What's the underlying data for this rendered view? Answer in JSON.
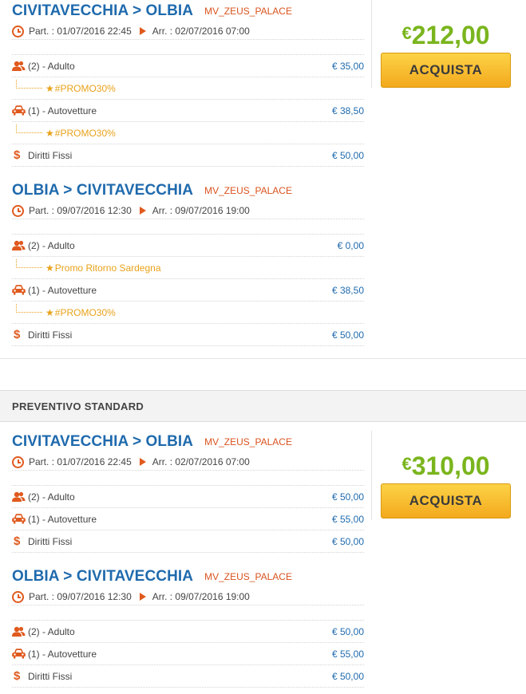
{
  "quote_promo": {
    "total_currency": "€",
    "total_amount": "212,00",
    "buy_label": "ACQUISTA",
    "legs": [
      {
        "route": "CIVITAVECCHIA > OLBIA",
        "ship": "MV_ZEUS_PALACE",
        "departure": "Part. : 01/07/2016 22:45",
        "arrival": "Arr. : 02/07/2016 07:00",
        "rows": [
          {
            "icon": "passengers-icon",
            "label": "(2) - Adulto",
            "price": "€ 35,00"
          },
          {
            "promo": "#PROMO30%"
          },
          {
            "icon": "car-icon",
            "label": "(1) - Autovetture",
            "price": "€ 38,50"
          },
          {
            "promo": "#PROMO30%"
          },
          {
            "icon": "dollar-icon",
            "label": "Diritti Fissi",
            "price": "€ 50,00"
          }
        ]
      },
      {
        "route": "OLBIA > CIVITAVECCHIA",
        "ship": "MV_ZEUS_PALACE",
        "departure": "Part. : 09/07/2016 12:30",
        "arrival": "Arr. : 09/07/2016 19:00",
        "rows": [
          {
            "icon": "passengers-icon",
            "label": "(2) - Adulto",
            "price": "€ 0,00"
          },
          {
            "promo": "Promo Ritorno Sardegna"
          },
          {
            "icon": "car-icon",
            "label": "(1) - Autovetture",
            "price": "€ 38,50"
          },
          {
            "promo": "#PROMO30%"
          },
          {
            "icon": "dollar-icon",
            "label": "Diritti Fissi",
            "price": "€ 50,00"
          }
        ]
      }
    ]
  },
  "section_standard_title": "PREVENTIVO STANDARD",
  "quote_standard": {
    "total_currency": "€",
    "total_amount": "310,00",
    "buy_label": "ACQUISTA",
    "legs": [
      {
        "route": "CIVITAVECCHIA > OLBIA",
        "ship": "MV_ZEUS_PALACE",
        "departure": "Part. : 01/07/2016 22:45",
        "arrival": "Arr. : 02/07/2016 07:00",
        "rows": [
          {
            "icon": "passengers-icon",
            "label": "(2) - Adulto",
            "price": "€ 50,00"
          },
          {
            "icon": "car-icon",
            "label": "(1) - Autovetture",
            "price": "€ 55,00"
          },
          {
            "icon": "dollar-icon",
            "label": "Diritti Fissi",
            "price": "€ 50,00"
          }
        ]
      },
      {
        "route": "OLBIA > CIVITAVECCHIA",
        "ship": "MV_ZEUS_PALACE",
        "departure": "Part. : 09/07/2016 12:30",
        "arrival": "Arr. : 09/07/2016 19:00",
        "rows": [
          {
            "icon": "passengers-icon",
            "label": "(2) - Adulto",
            "price": "€ 50,00"
          },
          {
            "icon": "car-icon",
            "label": "(1) - Autovetture",
            "price": "€ 55,00"
          },
          {
            "icon": "dollar-icon",
            "label": "Diritti Fissi",
            "price": "€ 50,00"
          }
        ]
      }
    ]
  },
  "colors": {
    "route_blue": "#1f6aad",
    "ship_red": "#d9531e",
    "icon_orange": "#e05a1e",
    "promo_gold": "#e8a21a",
    "total_green": "#7ab51d"
  }
}
